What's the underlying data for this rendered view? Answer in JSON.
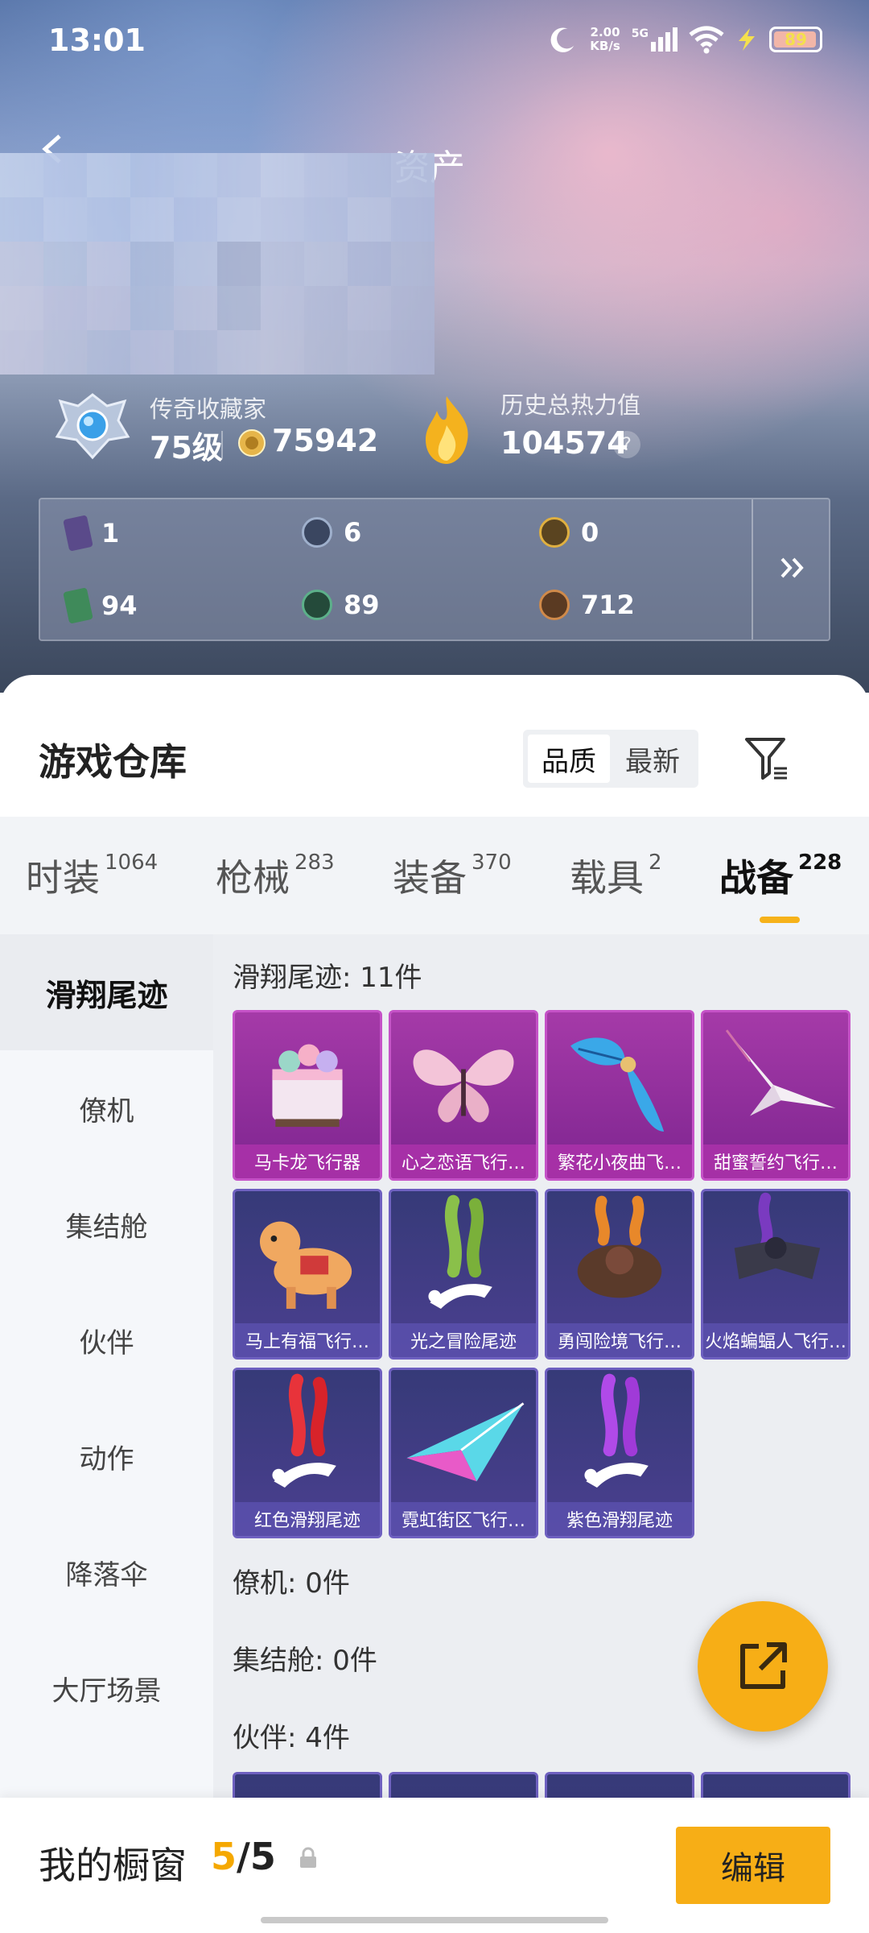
{
  "status_bar": {
    "time": "13:01",
    "net_speed_value": "2.00",
    "net_speed_unit": "KB/s",
    "network": "5G",
    "battery": "89"
  },
  "header": {
    "title": "资产"
  },
  "profile": {
    "collector_label": "传奇收藏家",
    "level": "75级",
    "coins": "75942",
    "heat_label": "历史总热力值",
    "heat_value": "104574",
    "help": "?"
  },
  "currencies": [
    {
      "value": "1",
      "color": "#6a5aa0",
      "icon": "purple-card-icon"
    },
    {
      "value": "6",
      "color": "#4a5a80",
      "icon": "silver-coin-icon"
    },
    {
      "value": "0",
      "color": "#8a6a20",
      "icon": "gold-coin-icon"
    },
    {
      "value": "94",
      "color": "#3f8a5a",
      "icon": "green-card-icon"
    },
    {
      "value": "89",
      "color": "#2f6a4a",
      "icon": "green-coin-icon"
    },
    {
      "value": "712",
      "color": "#8a5a30",
      "icon": "bronze-coin-icon"
    }
  ],
  "warehouse": {
    "title": "游戏仓库",
    "sort_quality": "品质",
    "sort_newest": "最新"
  },
  "tabs": [
    {
      "label": "时装",
      "count": "1064"
    },
    {
      "label": "枪械",
      "count": "283"
    },
    {
      "label": "装备",
      "count": "370"
    },
    {
      "label": "载具",
      "count": "2"
    },
    {
      "label": "战备",
      "count": "228"
    }
  ],
  "sidebar": [
    "滑翔尾迹",
    "僚机",
    "集结舱",
    "伙伴",
    "动作",
    "降落伞",
    "大厅场景"
  ],
  "sections": {
    "trails": "滑翔尾迹: 11件",
    "wingman": "僚机: 0件",
    "capsule": "集结舱: 0件",
    "partner": "伙伴: 4件"
  },
  "items": [
    {
      "name": "马卡龙飞行器",
      "rarity": "pink"
    },
    {
      "name": "心之恋语飞行…",
      "rarity": "pink"
    },
    {
      "name": "繁花小夜曲飞…",
      "rarity": "pink"
    },
    {
      "name": "甜蜜誓约飞行…",
      "rarity": "pink"
    },
    {
      "name": "马上有福飞行…",
      "rarity": "purple"
    },
    {
      "name": "光之冒险尾迹",
      "rarity": "purple"
    },
    {
      "name": "勇闯险境飞行…",
      "rarity": "purple"
    },
    {
      "name": "火焰蝙蝠人飞行…",
      "rarity": "purple"
    },
    {
      "name": "红色滑翔尾迹",
      "rarity": "purple"
    },
    {
      "name": "霓虹街区飞行…",
      "rarity": "purple"
    },
    {
      "name": "紫色滑翔尾迹",
      "rarity": "purple"
    }
  ],
  "showcase": {
    "label": "我的橱窗",
    "current": "5",
    "slash": "/",
    "total": "5",
    "edit": "编辑"
  }
}
